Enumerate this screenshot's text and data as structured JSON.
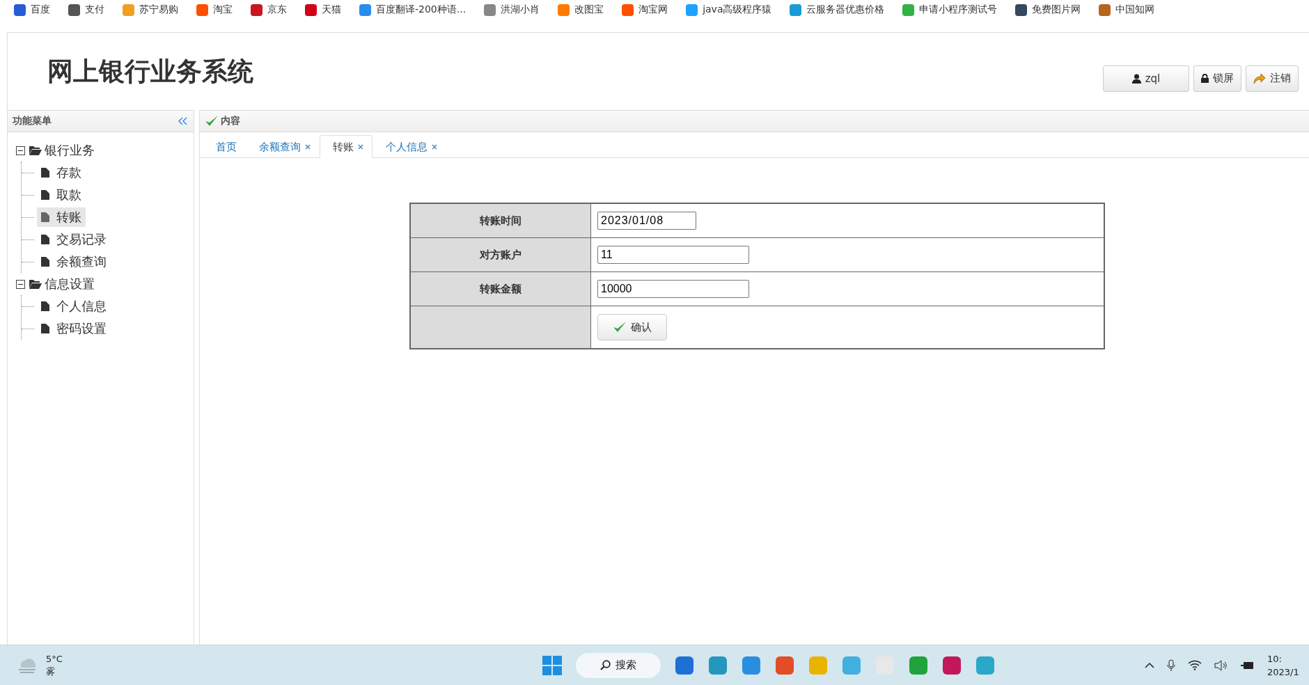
{
  "bookmarks": [
    {
      "label": "百度"
    },
    {
      "label": "支付"
    },
    {
      "label": "苏宁易购"
    },
    {
      "label": "淘宝"
    },
    {
      "label": "京东"
    },
    {
      "label": "天猫"
    },
    {
      "label": "百度翻译-200种语..."
    },
    {
      "label": "洪湖小肖"
    },
    {
      "label": "改图宝"
    },
    {
      "label": "淘宝网"
    },
    {
      "label": "java高级程序猿"
    },
    {
      "label": "云服务器优惠价格"
    },
    {
      "label": "申请小程序测试号"
    },
    {
      "label": "免费图片网"
    },
    {
      "label": "中国知网"
    }
  ],
  "header": {
    "title": "网上银行业务系统",
    "buttons": [
      {
        "label": "zql",
        "kind": "user"
      },
      {
        "label": "锁屏",
        "kind": "lock"
      },
      {
        "label": "注销",
        "kind": "logout"
      }
    ]
  },
  "sidebar": {
    "title": "功能菜单",
    "tree": [
      {
        "label": "银行业务",
        "expanded": true,
        "children": [
          {
            "label": "存款",
            "selected": false
          },
          {
            "label": "取款",
            "selected": false
          },
          {
            "label": "转账",
            "selected": true
          },
          {
            "label": "交易记录",
            "selected": false
          },
          {
            "label": "余额查询",
            "selected": false
          }
        ]
      },
      {
        "label": "信息设置",
        "expanded": true,
        "children": [
          {
            "label": "个人信息",
            "selected": false
          },
          {
            "label": "密码设置",
            "selected": false
          }
        ]
      }
    ]
  },
  "content": {
    "title": "内容",
    "tabs": [
      {
        "label": "首页",
        "selected": false,
        "closable": false
      },
      {
        "label": "余额查询",
        "selected": false,
        "closable": true
      },
      {
        "label": "转账",
        "selected": true,
        "closable": true
      },
      {
        "label": "个人信息",
        "selected": false,
        "closable": true
      }
    ],
    "form": {
      "fields": [
        {
          "label": "转账时间",
          "value": "2023/01/08",
          "kind": "date"
        },
        {
          "label": "对方账户",
          "value": "11",
          "kind": "text"
        },
        {
          "label": "转账金额",
          "value": "10000",
          "kind": "text"
        }
      ],
      "submit": "确认"
    }
  },
  "taskbar": {
    "weather": {
      "temp": "5°C",
      "condition": "雾"
    },
    "search": {
      "placeholder": "搜索"
    },
    "clock": {
      "time": "10:",
      "date": "2023/1"
    }
  }
}
